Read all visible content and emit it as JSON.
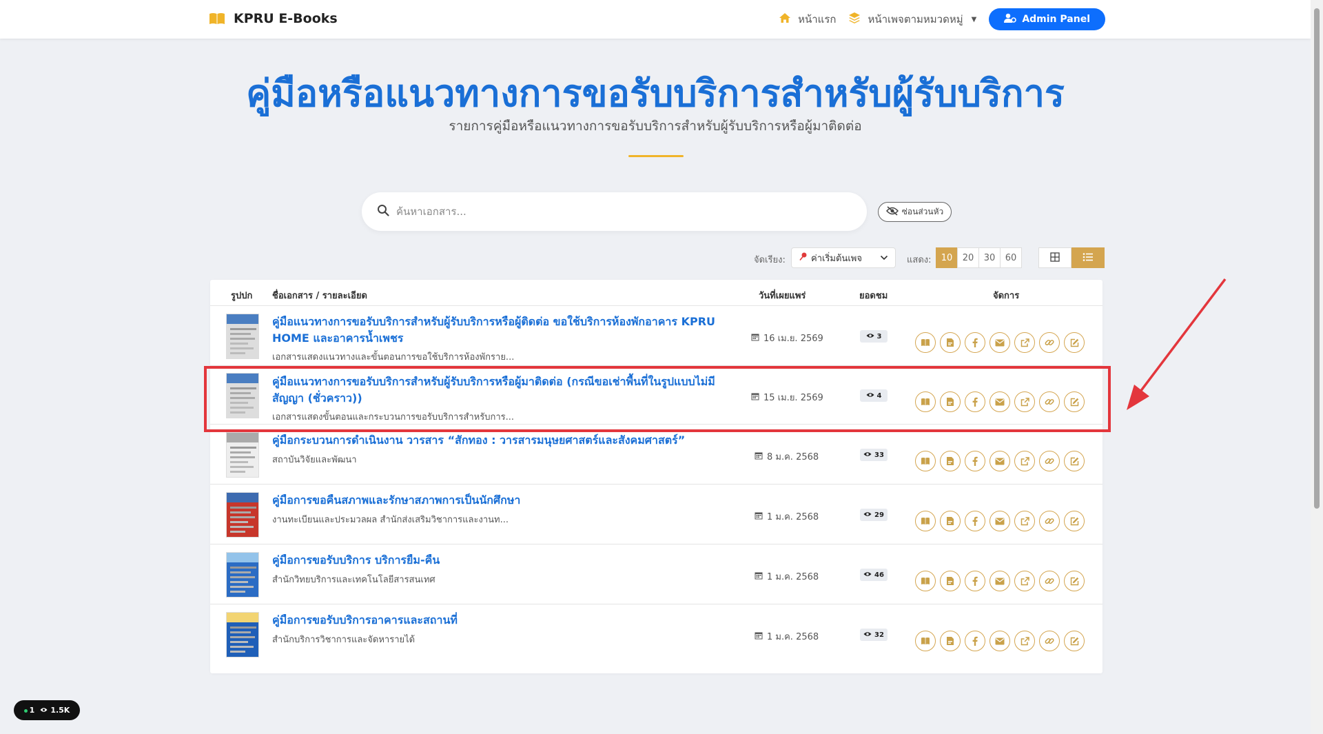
{
  "navbar": {
    "brand": "KPRU E-Books",
    "home_label": "หน้าแรก",
    "category_label": "หน้าเพจตามหมวดหมู่",
    "admin_label": "Admin Panel"
  },
  "header": {
    "title": "คู่มือหรือแนวทางการขอรับบริการสำหรับผู้รับบริการ",
    "subtitle": "รายการคู่มือหรือแนวทางการขอรับบริการสำหรับผู้รับบริการหรือผู้มาติดต่อ"
  },
  "search": {
    "placeholder": "ค้นหาเอกสาร...",
    "value": "",
    "hide_header_label": "ซ่อนส่วนหัว"
  },
  "controls": {
    "sort_label": "จัดเรียง:",
    "sort_value": "ค่าเริ่มต้นเพจ",
    "show_label": "แสดง:",
    "page_sizes": [
      "10",
      "20",
      "30",
      "60"
    ],
    "active_page_size": "10",
    "active_view": "list"
  },
  "table": {
    "headers": {
      "cover": "รูปปก",
      "name": "ชื่อเอกสาร / รายละเอียด",
      "date": "วันที่เผยแพร่",
      "views": "ยอดชม",
      "actions": "จัดการ"
    },
    "rows": [
      {
        "title": "คู่มือแนวทางการขอรับบริการสำหรับผู้รับบริการหรือผู้ติดต่อ ขอใช้บริการห้องพักอาคาร KPRU HOME และอาคารน้ำเพชร",
        "desc": "เอกสารแสดงแนวทางและขั้นตอนการขอใช้บริการห้องพักราย...",
        "date": "16 เม.ย. 2569",
        "views": "3"
      },
      {
        "title": "คู่มือแนวทางการขอรับบริการสำหรับผู้รับบริการหรือผู้มาติดต่อ (กรณีขอเช่าพื้นที่ในรูปแบบไม่มีสัญญา (ชั่วคราว))",
        "desc": "เอกสารแสดงขั้นตอนและกระบวนการขอรับบริการสำหรับการ...",
        "date": "15 เม.ย. 2569",
        "views": "4"
      },
      {
        "title": "คู่มือกระบวนการดำเนินงาน วารสาร “สักทอง : วารสารมนุษยศาสตร์และสังคมศาสตร์”",
        "desc": "สถาบันวิจัยและพัฒนา",
        "date": "8 ม.ค. 2568",
        "views": "33"
      },
      {
        "title": "คู่มือการขอคืนสภาพและรักษาสภาพการเป็นนักศึกษา",
        "desc": "งานทะเบียนและประมวลผล สำนักส่งเสริมวิชาการและงานท...",
        "date": "1 ม.ค. 2568",
        "views": "29"
      },
      {
        "title": "คู่มือการขอรับบริการ บริการยืม-คืน",
        "desc": "สำนักวิทยบริการและเทคโนโลยีสารสนเทศ",
        "date": "1 ม.ค. 2568",
        "views": "46"
      },
      {
        "title": "คู่มือการขอรับบริการอาคารและสถานที่",
        "desc": "สำนักบริการวิชาการและจัดหารายได้",
        "date": "1 ม.ค. 2568",
        "views": "32"
      }
    ]
  },
  "stats": {
    "online": "1",
    "views": "1.5K"
  },
  "colors": {
    "primary": "#1a6fd6",
    "accent_gold": "#d4a54f",
    "highlight_red": "#e3363c"
  }
}
